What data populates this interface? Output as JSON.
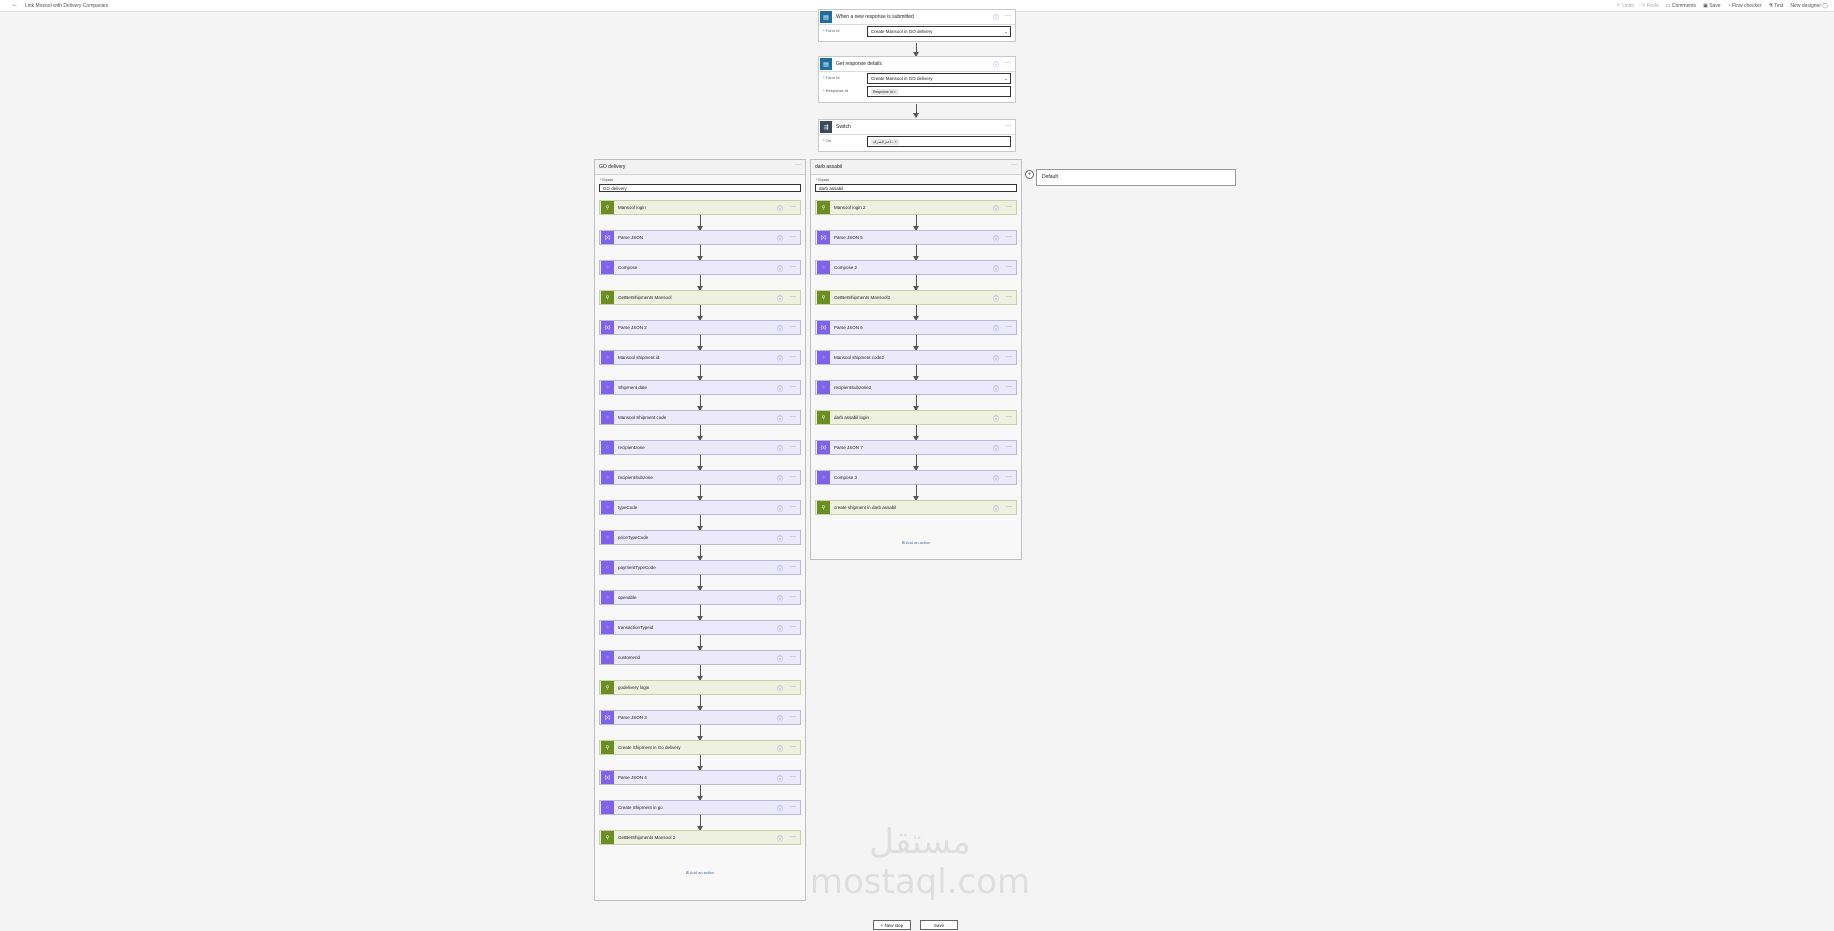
{
  "header": {
    "back_icon": "arrow-left-icon",
    "title": "Link Mosool with Delivery Companies",
    "toolbar": {
      "undo": "Undo",
      "redo": "Redo",
      "comments": "Comments",
      "save": "Save",
      "flow_checker": "Flow checker",
      "test": "Test",
      "new_designer": "New designer"
    }
  },
  "trigger": {
    "title": "When a new response is submitted",
    "form_label": "* Form Id",
    "form_value": "Create Mansool in GO delivery"
  },
  "get_response": {
    "title": "Get response details",
    "form_label": "* Form Id",
    "form_value": "Create Mansool in GO delivery",
    "response_label": "* Response Id",
    "response_token": "Response Id"
  },
  "switch": {
    "title": "Switch",
    "on_label": "* On",
    "on_token": "اختر الشركة..."
  },
  "cases": [
    {
      "title": "GO delivery",
      "equals_label": "* Equals",
      "equals_value": "GO delivery",
      "add_action": "Add an action",
      "actions": [
        {
          "label": "Mansool login",
          "kind": "green"
        },
        {
          "label": "Parse JSON",
          "kind": "purple"
        },
        {
          "label": "Compose",
          "kind": "purple"
        },
        {
          "label": "GetBetShipments Mansool",
          "kind": "green"
        },
        {
          "label": "Parse JSON 2",
          "kind": "purple"
        },
        {
          "label": "Mansool shipment id",
          "kind": "purple"
        },
        {
          "label": "Shipment date",
          "kind": "purple"
        },
        {
          "label": "Mansool Shipment code",
          "kind": "purple"
        },
        {
          "label": "recipientzone",
          "kind": "purple"
        },
        {
          "label": "recipientSubzone",
          "kind": "purple"
        },
        {
          "label": "typeCode",
          "kind": "purple"
        },
        {
          "label": "priceTypeCode",
          "kind": "purple"
        },
        {
          "label": "paymentTypeCode",
          "kind": "purple"
        },
        {
          "label": "openable",
          "kind": "purple"
        },
        {
          "label": "transactionTypeid",
          "kind": "purple"
        },
        {
          "label": "customerid",
          "kind": "purple"
        },
        {
          "label": "godelivery login",
          "kind": "green"
        },
        {
          "label": "Parse JSON 3",
          "kind": "purple"
        },
        {
          "label": "Create Shipment in Go delivery",
          "kind": "green"
        },
        {
          "label": "Parse JSON 4",
          "kind": "purple"
        },
        {
          "label": "Create Shipment in go",
          "kind": "purple"
        },
        {
          "label": "GetBetShipments Mansool 2",
          "kind": "green"
        }
      ]
    },
    {
      "title": "darb assabil",
      "equals_label": "* Equals",
      "equals_value": "darb assabil",
      "add_action": "Add an action",
      "actions": [
        {
          "label": "Mansool login 2",
          "kind": "green"
        },
        {
          "label": "Parse JSON 5",
          "kind": "purple"
        },
        {
          "label": "Compose 2",
          "kind": "purple"
        },
        {
          "label": "GetBetShipments Mansool3",
          "kind": "green"
        },
        {
          "label": "Parse JSON 6",
          "kind": "purple"
        },
        {
          "label": "Mansool shipment code2",
          "kind": "purple"
        },
        {
          "label": "recipientSubzone2",
          "kind": "purple"
        },
        {
          "label": "darb assabil login",
          "kind": "green"
        },
        {
          "label": "Parse JSON 7",
          "kind": "purple"
        },
        {
          "label": "Compose 3",
          "kind": "purple"
        },
        {
          "label": "create shipment in darb assabil",
          "kind": "green"
        }
      ]
    }
  ],
  "default_case": {
    "title": "Default"
  },
  "bottom": {
    "new_step": "+ New step",
    "save": "Save"
  },
  "watermark": "مستقل mostaql.com"
}
